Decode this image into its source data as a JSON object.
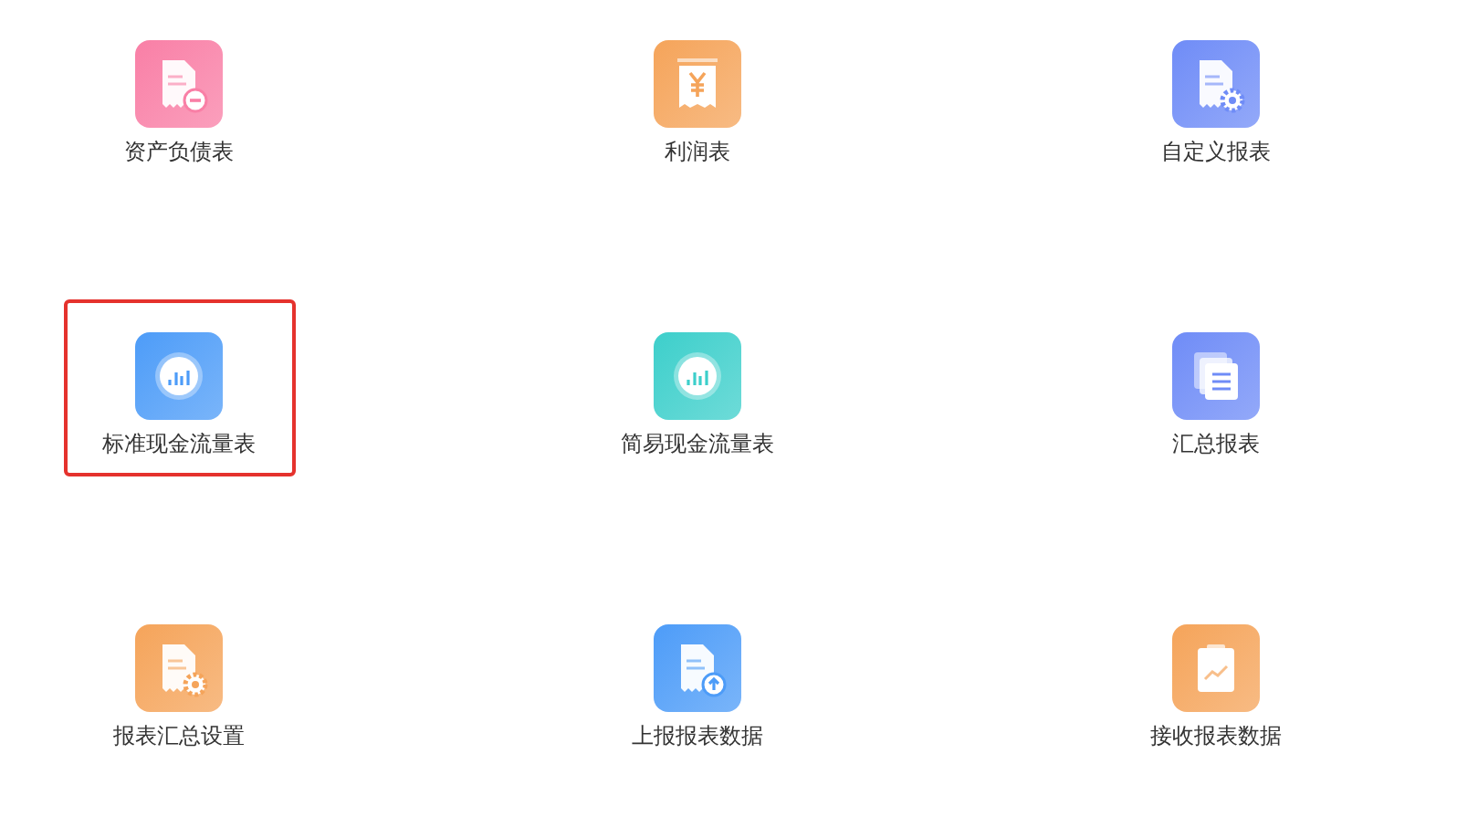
{
  "items": [
    {
      "label": "资产负债表",
      "kind": "doc-minus",
      "color": "#f97fa6",
      "selected": false
    },
    {
      "label": "利润表",
      "kind": "receipt-yen",
      "color": "#f5a45a",
      "selected": false
    },
    {
      "label": "自定义报表",
      "kind": "doc-gear",
      "color": "#6f8cf7",
      "selected": false
    },
    {
      "label": "标准现金流量表",
      "kind": "chart-circle",
      "color": "#4d9cf8",
      "selected": true
    },
    {
      "label": "简易现金流量表",
      "kind": "chart-circle",
      "color": "#3dcfcb",
      "selected": false
    },
    {
      "label": "汇总报表",
      "kind": "stack",
      "color": "#6f8cf7",
      "selected": false
    },
    {
      "label": "报表汇总设置",
      "kind": "doc-gear",
      "color": "#f5a45a",
      "selected": false
    },
    {
      "label": "上报报表数据",
      "kind": "doc-upload",
      "color": "#4d9cf8",
      "selected": false
    },
    {
      "label": "接收报表数据",
      "kind": "clipboard-chart",
      "color": "#f5a45a",
      "selected": false
    }
  ]
}
